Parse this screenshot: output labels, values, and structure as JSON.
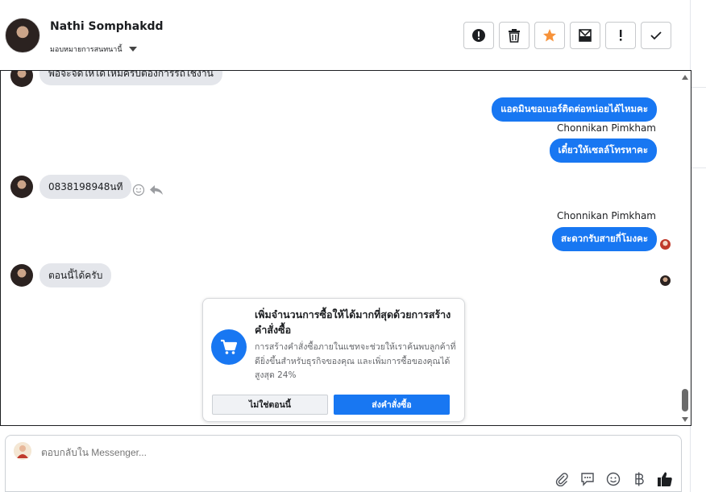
{
  "header": {
    "name": "Nathi Somphakdd",
    "assign_label": "มอบหมายการสนทนานี้"
  },
  "toolbar": {
    "buttons": [
      {
        "icon": "alert-circle-icon"
      },
      {
        "icon": "trash-icon"
      },
      {
        "icon": "star-icon",
        "color": "#f7923a"
      },
      {
        "icon": "mark-unread-icon"
      },
      {
        "icon": "exclamation-icon"
      },
      {
        "icon": "check-icon"
      }
    ]
  },
  "messages": {
    "m0": "พอจะจัดให้ได้ไหมครับต้องการรถใช้งาน",
    "m1": "แอดมินขอเบอร์ติดต่อหน่อยได้ไหมคะ",
    "s1": "Chonnikan Pimkham",
    "m2": "เดี๋ยวให้เซลล์โทรหาคะ",
    "m3": "0838198948นที",
    "s2": "Chonnikan Pimkham",
    "m4": "สะดวกรับสายกี่โมงคะ",
    "m5": "ตอนนี้ได้ครับ"
  },
  "card": {
    "title": "เพิ่มจำนวนการซื้อให้ได้มากที่สุดด้วยการสร้างคำสั่งซื้อ",
    "desc": "การสร้างคำสั่งซื้อภายในแชทจะช่วยให้เราค้นพบลูกค้าที่ดียิ่งขึ้นสำหรับธุรกิจของคุณ และเพิ่มการซื้อของคุณได้สูงสุด 24%",
    "secondary_label": "ไม่ใช่ตอนนี้",
    "primary_label": "ส่งคำสั่งซื้อ"
  },
  "composer": {
    "placeholder": "ตอบกลับใน Messenger..."
  },
  "colors": {
    "accent": "#1877f2",
    "bubble_in": "#e4e6eb"
  }
}
